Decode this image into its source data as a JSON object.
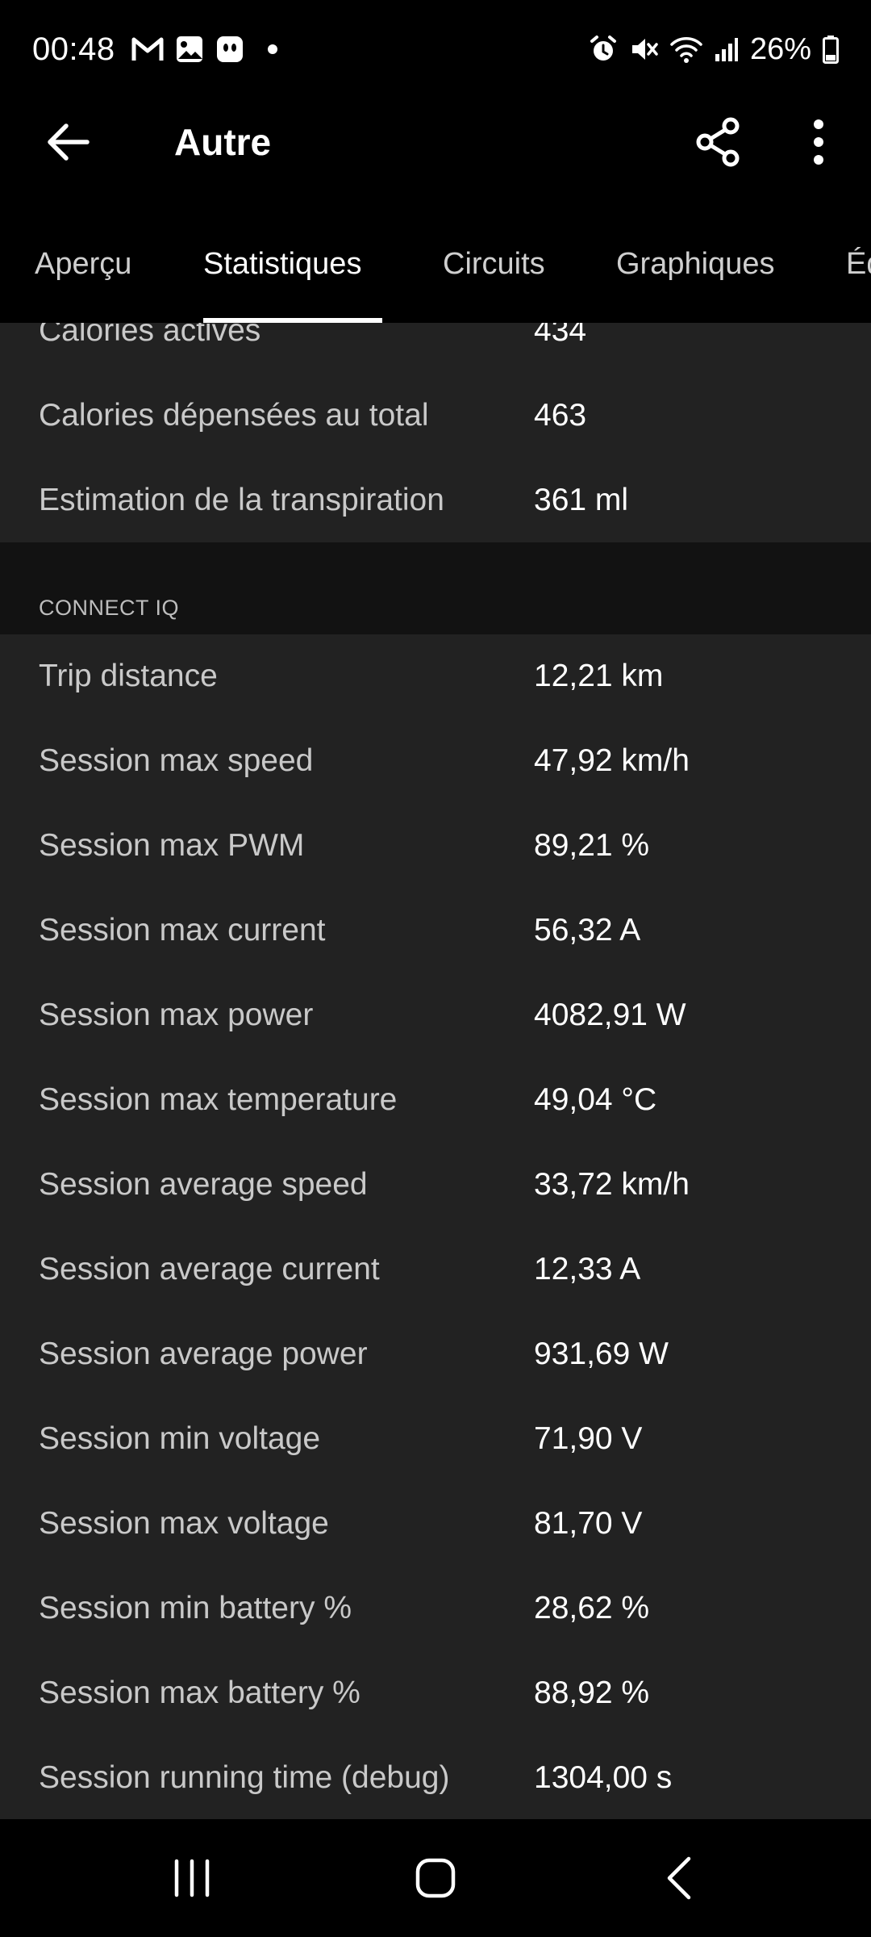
{
  "status_bar": {
    "time": "00:48",
    "battery_percent": "26%",
    "left_icons": [
      "gmail-icon",
      "gallery-icon",
      "ghost-app-icon",
      "dot-icon"
    ],
    "right_icons": [
      "alarm-icon",
      "mute-icon",
      "wifi-icon",
      "signal-icon",
      "battery-icon"
    ]
  },
  "app_bar": {
    "title": "Autre"
  },
  "tabs": [
    {
      "label": "Aperçu"
    },
    {
      "label": "Statistiques",
      "active": true
    },
    {
      "label": "Circuits"
    },
    {
      "label": "Graphiques"
    },
    {
      "label": "Éq"
    }
  ],
  "stats_top": [
    {
      "label": "Calories actives",
      "value": "434"
    },
    {
      "label": "Calories dépensées au total",
      "value": "463"
    },
    {
      "label": "Estimation de la transpiration",
      "value": "361 ml"
    }
  ],
  "connect_iq": {
    "title": "CONNECT IQ",
    "rows": [
      {
        "label": "Trip distance",
        "value": "12,21 km"
      },
      {
        "label": "Session max speed",
        "value": "47,92 km/h"
      },
      {
        "label": "Session max PWM",
        "value": "89,21 %"
      },
      {
        "label": "Session max current",
        "value": "56,32 A"
      },
      {
        "label": "Session max power",
        "value": "4082,91 W"
      },
      {
        "label": "Session max temperature",
        "value": "49,04 °C"
      },
      {
        "label": "Session average speed",
        "value": "33,72 km/h"
      },
      {
        "label": "Session average current",
        "value": "12,33 A"
      },
      {
        "label": "Session average power",
        "value": "931,69 W"
      },
      {
        "label": "Session min voltage",
        "value": "71,90 V"
      },
      {
        "label": "Session max voltage",
        "value": "81,70 V"
      },
      {
        "label": "Session min battery %",
        "value": "28,62 %"
      },
      {
        "label": "Session max battery %",
        "value": "88,92 %"
      },
      {
        "label": "Session running time (debug)",
        "value": "1304,00 s"
      }
    ]
  },
  "nav_bar": {
    "icons": [
      "recent-apps-icon",
      "home-icon",
      "back-nav-icon"
    ]
  }
}
